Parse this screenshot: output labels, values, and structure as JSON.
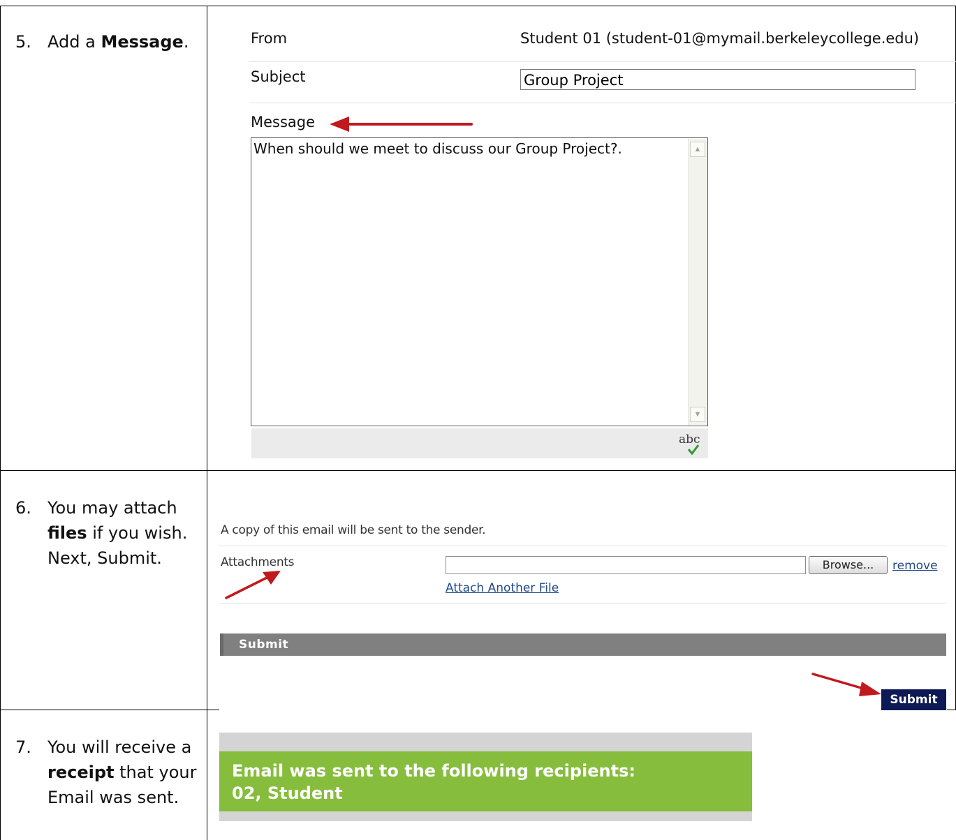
{
  "steps": [
    {
      "number": "5.",
      "pre": "Add a ",
      "bold": "Message",
      "post": "."
    },
    {
      "number": "6.",
      "pre": "You may attach ",
      "bold": "files",
      "post": " if you wish. Next, Submit."
    },
    {
      "number": "7.",
      "pre": "You will receive a ",
      "bold": "receipt",
      "post": " that your Email was sent."
    }
  ],
  "compose": {
    "from_label": "From",
    "from_value": "Student 01 (student-01@mymail.berkeleycollege.edu)",
    "subject_label": "Subject",
    "subject_value": "Group Project",
    "message_label": "Message",
    "message_value": "When should we meet to discuss our Group Project?.",
    "spellcheck_icon": "abc"
  },
  "attachments": {
    "copy_notice": "A copy of this email will be sent to the sender.",
    "label": "Attachments",
    "file_value": "",
    "browse_label": "Browse...",
    "remove_label": "remove",
    "attach_another_label": "Attach Another File",
    "submit_bar_label": "Submit",
    "submit_button_label": "Submit"
  },
  "receipt": {
    "line1": "Email was sent to the following recipients:",
    "line2": "02, Student"
  },
  "colors": {
    "arrow": "#c0191e",
    "receipt_green": "#86bd3d",
    "submit_navy": "#0e1a55",
    "submit_bar_gray": "#808080",
    "link_blue": "#1f4a8a"
  }
}
